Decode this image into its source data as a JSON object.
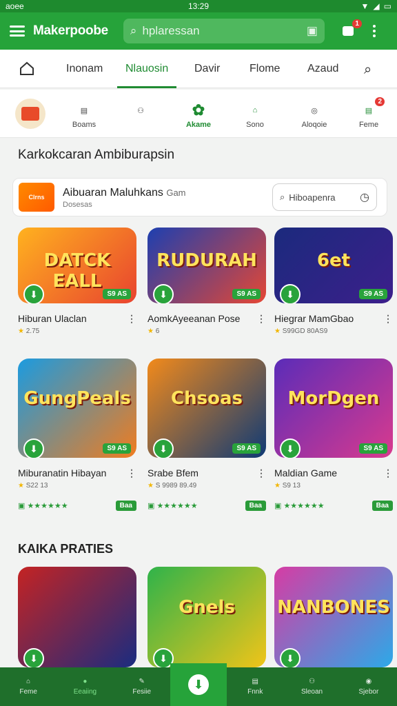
{
  "status": {
    "left": "aoee",
    "time": "13:29"
  },
  "appbar": {
    "brand": "Makerpoobe",
    "search_placeholder": "hplaressan",
    "notif_count": "1"
  },
  "tabs": [
    "Inonam",
    "Nlauosin",
    "Davir",
    "Flome",
    "Azaud"
  ],
  "active_tab": 1,
  "categories": [
    {
      "label": "Boams",
      "icon": "notes-icon"
    },
    {
      "label": "",
      "icon": "people-icon"
    },
    {
      "label": "Akame",
      "icon": "game-icon"
    },
    {
      "label": "Sono",
      "icon": "home-icon"
    },
    {
      "label": "Aloqoie",
      "icon": "profile-icon"
    },
    {
      "label": "Feme",
      "icon": "list-icon",
      "badge": "2"
    }
  ],
  "section1": {
    "title": "Karkokcaran Ambiburapsin"
  },
  "promo": {
    "logo": "Clrns",
    "title": "Aibuaran Maluhkans",
    "title_small": "Gam",
    "subtitle": "Dosesas",
    "box_text": "Hiboapenra"
  },
  "games_row1": [
    {
      "name": "Hiburan Ulaclan",
      "rating": "2.75",
      "tag": "S9 AS",
      "art": "DATCK EALL",
      "colors": [
        "#ffb21f",
        "#e8432f"
      ]
    },
    {
      "name": "AomkAyeeanan Pose",
      "rating": "6",
      "tag": "S9 AS",
      "art": "RUDURAH",
      "colors": [
        "#1d3fb0",
        "#e54734"
      ]
    },
    {
      "name": "Hiegrar MamGbao",
      "rating": "S99GD 80AS9",
      "tag": "S9 AS",
      "art": "6et",
      "colors": [
        "#1b2a7d",
        "#3c1f8b"
      ]
    }
  ],
  "games_row2": [
    {
      "name": "Miburanatin Hibayan",
      "rating": "S22 13",
      "tag": "S9 AS",
      "art": "GungPeals",
      "colors": [
        "#1b9be0",
        "#f07c1f"
      ]
    },
    {
      "name": "Srabe Bfem",
      "rating": "S 9989 89.49",
      "tag": "S9 AS",
      "art": "Chsoas",
      "colors": [
        "#f28a1b",
        "#0f3a75"
      ]
    },
    {
      "name": "Maldian Game",
      "rating": "S9 13",
      "tag": "S9 AS",
      "art": "MorDgen",
      "colors": [
        "#5b2cb8",
        "#d93a8e"
      ]
    }
  ],
  "download_pill": "Baa",
  "section2": {
    "title": "KAIKA PRATIES"
  },
  "games_row3": [
    {
      "art": "",
      "colors": [
        "#c42323",
        "#1a2c80"
      ]
    },
    {
      "art": "Gnels",
      "colors": [
        "#2fb34a",
        "#f0c419"
      ]
    },
    {
      "art": "NANBONES",
      "colors": [
        "#d63ca4",
        "#2ca9e8"
      ]
    }
  ],
  "bottom_nav": [
    "Feme",
    "Eeaiing",
    "Fesiie",
    "",
    "Fnnk",
    "Sleoan",
    "Sjebor"
  ],
  "colors": {
    "primary": "#26a33a",
    "dark": "#1f6f2b"
  }
}
